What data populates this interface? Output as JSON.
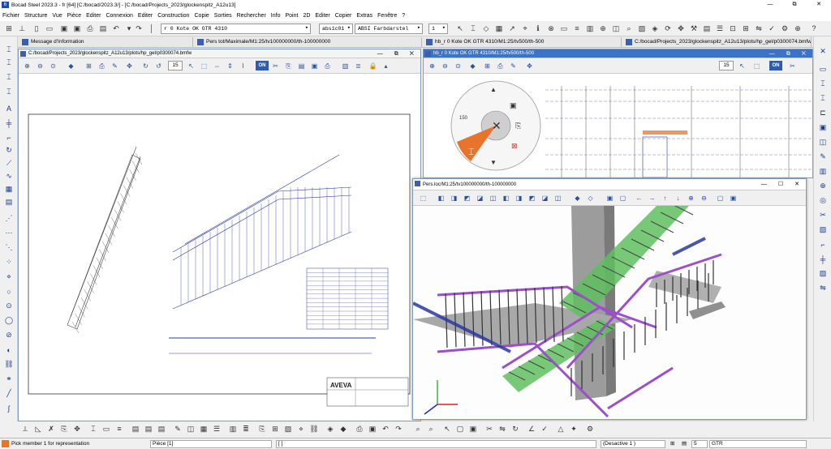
{
  "app": {
    "title": "Bocad Steel 2023.3 - fr [64]  [C:/bocad/2023.3/]  - [C:/bocad/Projects_2023/glockenspitz_A12u13]",
    "window_controls": [
      "—",
      "⧉",
      "✕"
    ]
  },
  "menu": [
    "Fichier",
    "Structure",
    "Vue",
    "Pièce",
    "Editer",
    "Connexion",
    "Editer",
    "Construction",
    "Copie",
    "Sorties",
    "Rechercher",
    "Info",
    "Point",
    "2D",
    "Editer",
    "Copier",
    "Extras",
    "Fenêtre",
    "?"
  ],
  "toolbar": {
    "plane_field": "r 0 Kote OK GTR 4310",
    "layer_field": "abs1c01",
    "color_field": "ABSI Farbdarstel",
    "num_field": "1"
  },
  "tabs": [
    {
      "label": "Message d'Information"
    },
    {
      "label": "Pers tot/Maximale/M1:25/tv100000000/th-100000000"
    },
    {
      "label": "hb_r 0 Kote OK GTR 4310/M1:25/tv500/th-500"
    },
    {
      "label": "C:/bocad/Projects_2023/glockenspitz_A12u13/plots/hp_gel/p0300074.bmfw"
    }
  ],
  "windows": {
    "drawing": {
      "title": "C:/bocad/Projects_2023/glockenspitz_A12u13/plots/hp_gel/p0300074.bmfw",
      "scale_value": "15",
      "on_label": "ON",
      "logo": "AVEVA"
    },
    "plan": {
      "title": "hb_r 0 Kote OK GTR 4310/M1:25/tv500/th-500",
      "scale_value": "15",
      "on_label": "ON",
      "dim_label": "150"
    },
    "pers": {
      "title": "Pers.loc/M1:25/tv100000000/th-100000000"
    }
  },
  "status": {
    "message": "Pick member 1 for representation",
    "mode": "Pièce [1]",
    "bracket": "[ ]",
    "deactive": "(Desactive 1 )",
    "num": "5",
    "unit": "GTR"
  },
  "colors": {
    "accent": "#2f5bb7",
    "menu_orange": "#e8742c",
    "steel_purple": "#9b4fc8",
    "steel_green": "#5fbf5f"
  }
}
